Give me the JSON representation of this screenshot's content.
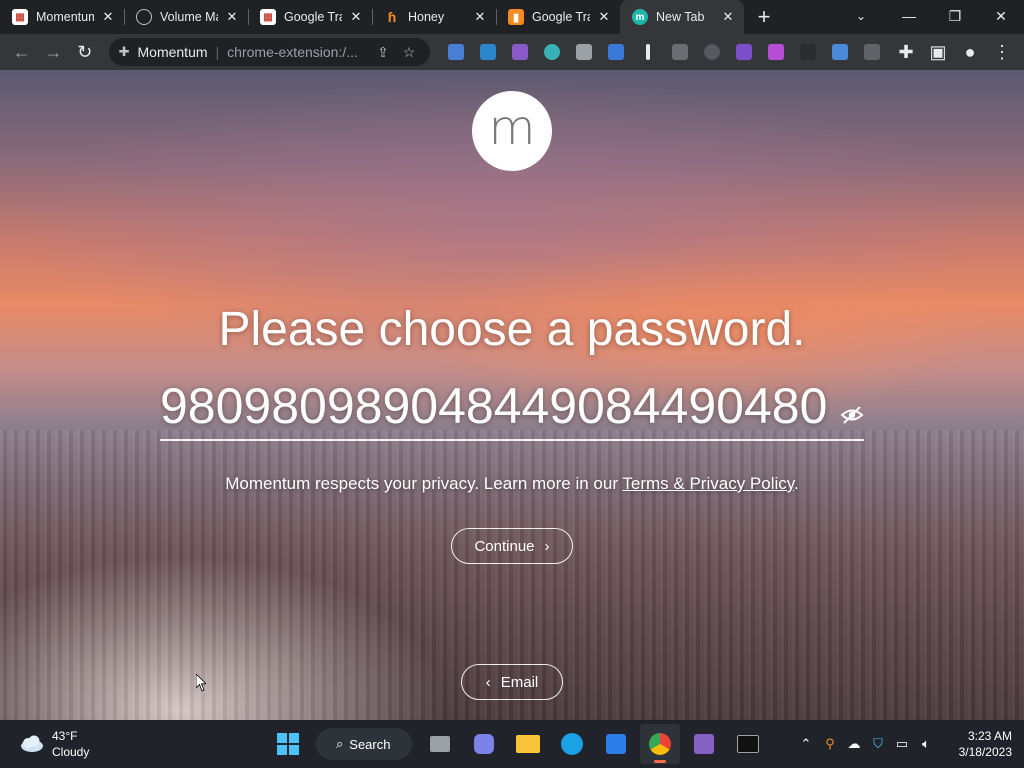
{
  "browser": {
    "tabs": [
      {
        "title": "Momentum",
        "favicon_color": "#c94b3b",
        "active": false
      },
      {
        "title": "Volume Ma",
        "favicon_color": "#bdc1c6",
        "active": false
      },
      {
        "title": "Google Tra",
        "favicon_color": "#c94b3b",
        "active": false
      },
      {
        "title": "Honey",
        "favicon_color": "#f58a23",
        "active": false
      },
      {
        "title": "Google Tra",
        "favicon_color": "#f58a23",
        "active": false
      },
      {
        "title": "New Tab",
        "favicon_color": "#1fb5a8",
        "active": true
      }
    ],
    "address": {
      "site": "Momentum",
      "url": "chrome-extension:/..."
    }
  },
  "page": {
    "logo_letter": "m",
    "heading": "Please choose a password.",
    "password_value": "980980989048449084490480",
    "privacy_text": "Momentum respects your privacy. Learn more in our",
    "privacy_link": "Terms & Privacy Policy",
    "privacy_end": ".",
    "continue_label": "Continue",
    "email_label": "Email"
  },
  "taskbar": {
    "temperature": "43°F",
    "condition": "Cloudy",
    "search_label": "Search",
    "time": "3:23 AM",
    "date": "3/18/2023"
  },
  "colors": {
    "accent": "#1fb5a8",
    "taskbar_bg": "#20242a",
    "chrome_bg": "#202124"
  }
}
